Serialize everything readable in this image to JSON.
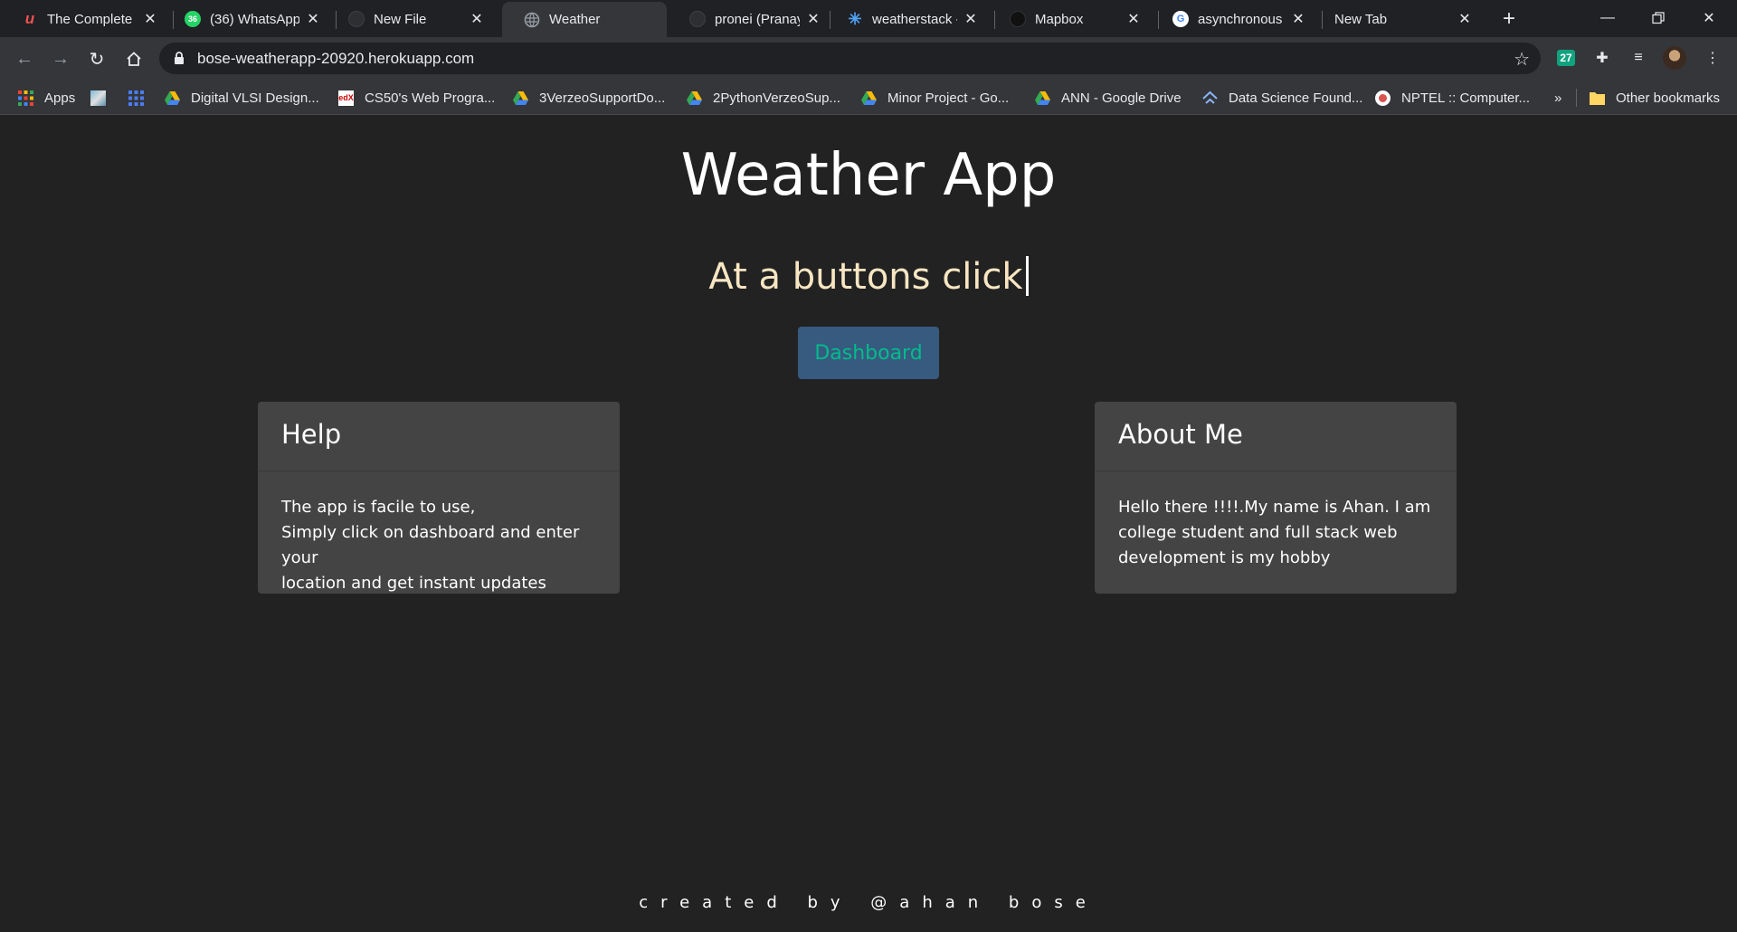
{
  "browser": {
    "tabs": [
      {
        "title": "The Complete I",
        "icon": "udemy-icon",
        "active": false
      },
      {
        "title": "(36) WhatsApp",
        "icon": "whatsapp-icon",
        "active": false
      },
      {
        "title": "New File",
        "icon": "github-icon",
        "active": false
      },
      {
        "title": "Weather",
        "icon": "globe-icon",
        "active": true
      },
      {
        "title": "pronei (Pranay",
        "icon": "github-icon",
        "active": false
      },
      {
        "title": "weatherstack -",
        "icon": "weatherstack-icon",
        "active": false
      },
      {
        "title": "Mapbox",
        "icon": "mapbox-icon",
        "active": false
      },
      {
        "title": "asynchronous -",
        "icon": "google-icon",
        "active": false
      },
      {
        "title": "New Tab",
        "icon": "",
        "active": false
      }
    ],
    "new_tab_symbol": "+",
    "url": "bose-weatherapp-20920.herokuapp.com",
    "extension_badge": "27",
    "bookmarks": [
      {
        "label": "Apps",
        "icon": "apps-grid-icon"
      },
      {
        "label": "",
        "icon": "image-bookmark-icon"
      },
      {
        "label": "",
        "icon": "grid-bookmark-icon"
      },
      {
        "label": "Digital VLSI Design...",
        "icon": "drive-icon"
      },
      {
        "label": "CS50's Web Progra...",
        "icon": "edx-icon"
      },
      {
        "label": "3VerzeoSupportDo...",
        "icon": "drive-icon"
      },
      {
        "label": "2PythonVerzeoSup...",
        "icon": "drive-icon"
      },
      {
        "label": "Minor Project - Go...",
        "icon": "drive-icon"
      },
      {
        "label": "ANN - Google Drive",
        "icon": "drive-icon"
      },
      {
        "label": "Data Science Found...",
        "icon": "data-science-icon"
      },
      {
        "label": "NPTEL :: Computer...",
        "icon": "nptel-icon"
      }
    ],
    "overflow_symbol": "»",
    "other_bookmarks": "Other bookmarks"
  },
  "page": {
    "title": "Weather App",
    "typed_text": "At a buttons click",
    "dashboard_button": "Dashboard",
    "help_card": {
      "title": "Help",
      "lines": [
        "The app is facile to use,",
        "Simply click on dashboard and enter your",
        "location and get instant updates"
      ]
    },
    "about_card": {
      "title": "About Me",
      "lines": [
        "Hello there !!!!.My name is Ahan. I am",
        "college student and full stack web",
        "development is my hobby"
      ]
    },
    "footer": "created by @ahan bose"
  },
  "colors": {
    "page_background": "#222222",
    "card_background": "#444444",
    "button_background": "#375a7f",
    "button_text": "#00bc8c",
    "typed_text": "#f8e6c2"
  }
}
